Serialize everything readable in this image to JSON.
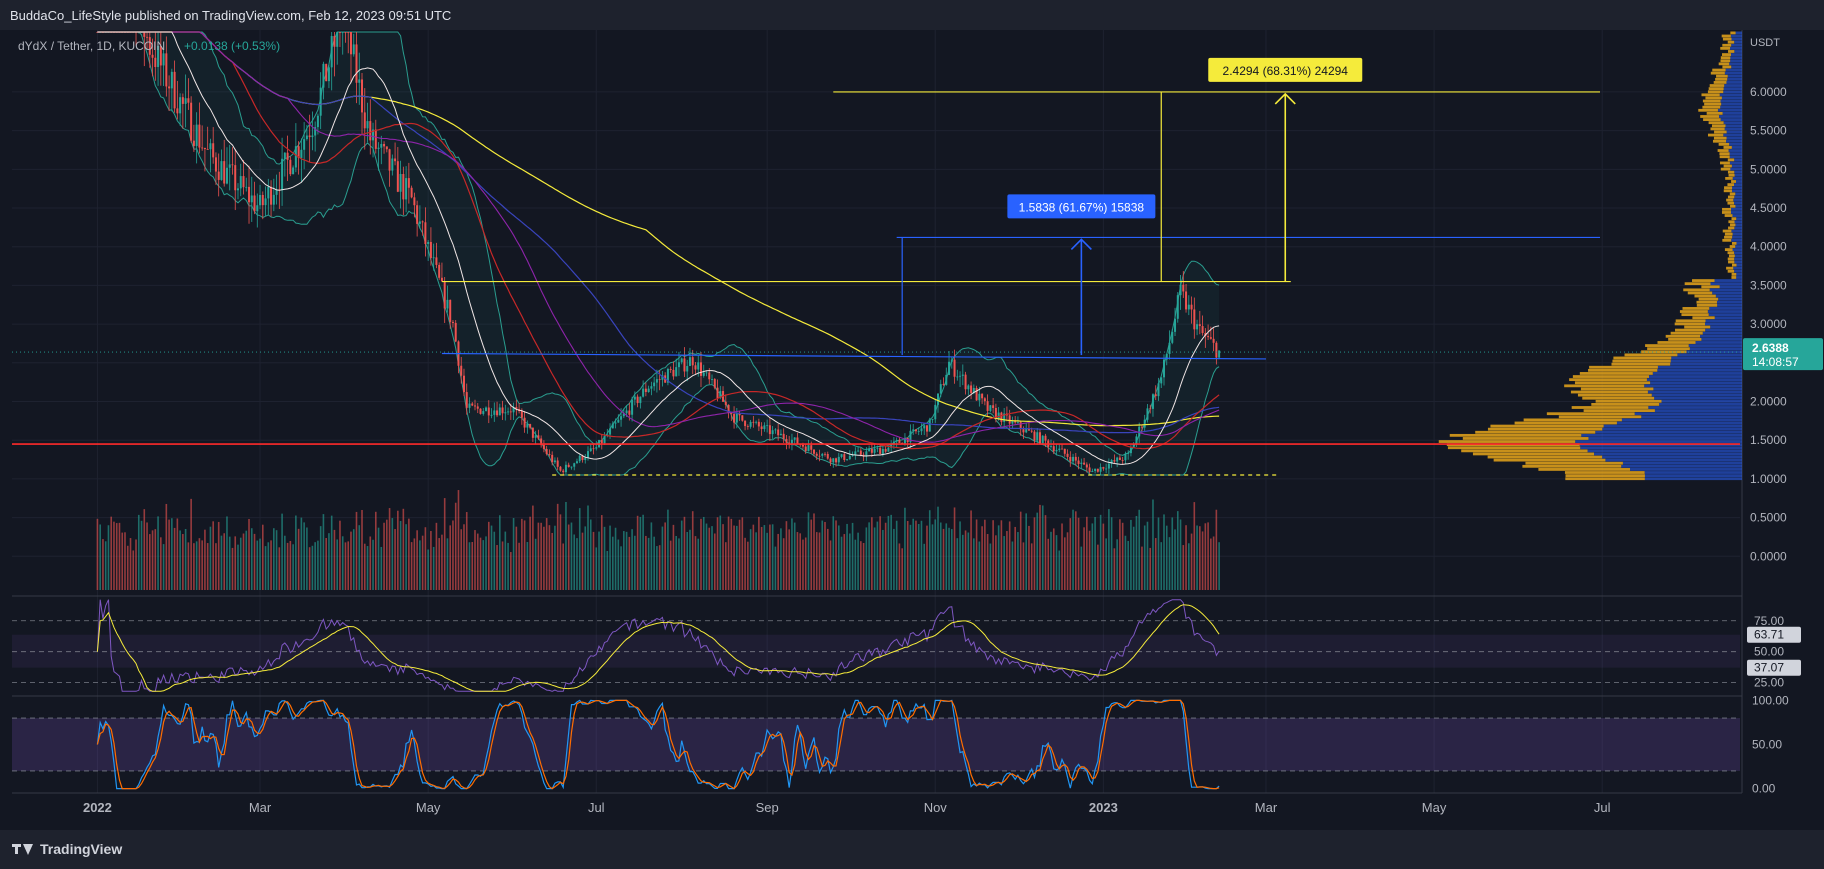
{
  "header": {
    "published": "BuddaCo_LifeStyle published on TradingView.com, Feb 12, 2023 09:51 UTC"
  },
  "footer": {
    "logo_text": "TradingView"
  },
  "colors": {
    "bg": "#131722",
    "up": "#26a69a",
    "down": "#ef5350",
    "yellow": "#f5eb3b",
    "blue": "#2962ff",
    "red_line": "#ff2a2a",
    "rsi": "#7e57c2",
    "stoch_k": "#2196f3",
    "stoch_d": "#ff6d00"
  },
  "chart_data": [
    {
      "type": "candlestick",
      "symbol": "dYdX / Tether, 1D, KUCOIN",
      "change": "+0.0138 (+0.53%)",
      "currency": "USDT",
      "x_ticks": [
        "2022",
        "Mar",
        "May",
        "Jul",
        "Sep",
        "Nov",
        "2023",
        "Mar",
        "May",
        "Jul"
      ],
      "y_ticks": [
        "0.0000",
        "0.5000",
        "1.0000",
        "1.5000",
        "2.0000",
        "2.5000",
        "3.0000",
        "3.5000",
        "4.0000",
        "4.5000",
        "5.0000",
        "5.5000",
        "6.0000"
      ],
      "ylim": [
        -0.5,
        6.8
      ],
      "last_price": "2.6388",
      "countdown": "14:08:57",
      "horizontal_levels": [
        {
          "name": "support",
          "value": 1.45,
          "color": "#ff2a2a"
        },
        {
          "name": "resistance",
          "value": 3.55,
          "color": "#f5eb3b"
        },
        {
          "name": "range-low",
          "value": 1.05,
          "color": "#f5eb3b"
        },
        {
          "name": "range-high",
          "value": 2.6,
          "color": "#2962ff"
        },
        {
          "name": "target-blue",
          "value": 4.12,
          "color": "#2962ff"
        },
        {
          "name": "target-yellow",
          "value": 6.0,
          "color": "#f5eb3b"
        }
      ],
      "measurements": [
        {
          "label": "1.5838 (61.67%) 15838",
          "color": "#2962ff"
        },
        {
          "label": "2.4294 (68.31%) 24294",
          "color": "#f5eb3b"
        }
      ],
      "price_path": [
        {
          "d": "2022-01-01",
          "v": 8.5
        },
        {
          "d": "2022-01-20",
          "v": 6.6
        },
        {
          "d": "2022-02-10",
          "v": 5.2
        },
        {
          "d": "2022-03-01",
          "v": 4.5
        },
        {
          "d": "2022-03-20",
          "v": 5.6
        },
        {
          "d": "2022-03-31",
          "v": 7.0
        },
        {
          "d": "2022-04-10",
          "v": 5.4
        },
        {
          "d": "2022-04-25",
          "v": 4.6
        },
        {
          "d": "2022-05-10",
          "v": 3.0
        },
        {
          "d": "2022-05-15",
          "v": 1.9
        },
        {
          "d": "2022-06-01",
          "v": 1.9
        },
        {
          "d": "2022-06-18",
          "v": 1.1
        },
        {
          "d": "2022-07-01",
          "v": 1.4
        },
        {
          "d": "2022-07-20",
          "v": 2.2
        },
        {
          "d": "2022-08-05",
          "v": 2.55
        },
        {
          "d": "2022-08-20",
          "v": 1.8
        },
        {
          "d": "2022-09-10",
          "v": 1.5
        },
        {
          "d": "2022-09-25",
          "v": 1.25
        },
        {
          "d": "2022-10-15",
          "v": 1.4
        },
        {
          "d": "2022-10-30",
          "v": 1.7
        },
        {
          "d": "2022-11-06",
          "v": 2.5
        },
        {
          "d": "2022-11-20",
          "v": 1.9
        },
        {
          "d": "2022-12-10",
          "v": 1.5
        },
        {
          "d": "2022-12-28",
          "v": 1.1
        },
        {
          "d": "2023-01-10",
          "v": 1.3
        },
        {
          "d": "2023-01-22",
          "v": 2.3
        },
        {
          "d": "2023-01-29",
          "v": 3.4
        },
        {
          "d": "2023-02-05",
          "v": 2.9
        },
        {
          "d": "2023-02-12",
          "v": 2.6388
        }
      ]
    },
    {
      "type": "line",
      "name": "RSI",
      "y_ticks": [
        "25.00",
        "50.00",
        "75.00"
      ],
      "ylim": [
        15,
        95
      ],
      "labels": [
        "63.71",
        "37.07"
      ],
      "band": [
        37.07,
        63.71
      ]
    },
    {
      "type": "line",
      "name": "Stochastic RSI",
      "y_ticks": [
        "0.00",
        "50.00",
        "100.00"
      ],
      "ylim": [
        -5,
        105
      ],
      "band": [
        20,
        80
      ]
    }
  ]
}
